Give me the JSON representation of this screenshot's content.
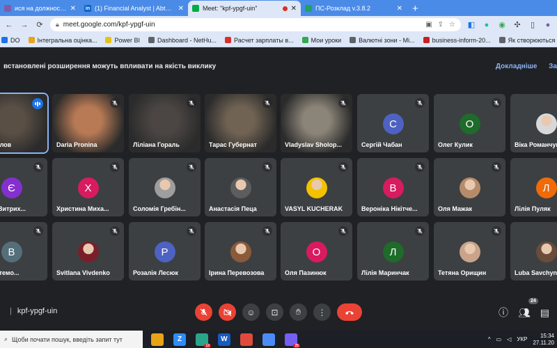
{
  "tabs": [
    {
      "title": "ися на должность «Finan",
      "favicon": "#7b5ea8",
      "letter": "",
      "active": false
    },
    {
      "title": "(1) Financial Analyst | Abto Softw",
      "favicon": "#0a66c2",
      "letter": "in",
      "active": false
    },
    {
      "title": "Meet: \"kpf-ypgf-uin\"",
      "favicon": "#00ac47",
      "letter": "",
      "active": true
    },
    {
      "title": "ПС-Розклад v.3.8.2",
      "favicon": "#1ea362",
      "letter": "",
      "active": false
    }
  ],
  "address": {
    "url": "meet.google.com/kpf-ypgf-uin"
  },
  "bookmarks": [
    {
      "label": "DO",
      "color": "#1a73e8"
    },
    {
      "label": "Інтегральна оцінка...",
      "color": "#e8a317"
    },
    {
      "label": "Power BI",
      "color": "#e8c117"
    },
    {
      "label": "Dashboard - NetHu...",
      "color": "#5f6368"
    },
    {
      "label": "Расчет зарплаты в...",
      "color": "#d93025"
    },
    {
      "label": "Мои уроки",
      "color": "#34a853"
    },
    {
      "label": "Валютні зони - Mi...",
      "color": "#5f6368"
    },
    {
      "label": "business-inform-20...",
      "color": "#c5221f"
    },
    {
      "label": "Як створюються гр...",
      "color": "#5f6368"
    },
    {
      "label": "Усі",
      "color": "#e8a317"
    }
  ],
  "banner": {
    "text": "встановлені розширення можуть впливати на якість виклику",
    "link": "Докладніше",
    "close": "За"
  },
  "participants": [
    {
      "name": "Михайлов",
      "kind": "video",
      "bg": "#5a4f45",
      "speaking": true
    },
    {
      "name": "Daria Pronina",
      "kind": "video",
      "bg": "#b87a55",
      "speaking": false
    },
    {
      "name": "Ліліана Гораль",
      "kind": "video",
      "bg": "#4b4643",
      "speaking": false
    },
    {
      "name": "Тарас Губернат",
      "kind": "video",
      "bg": "#706353",
      "speaking": false
    },
    {
      "name": "Vladyslav Sholop...",
      "kind": "video",
      "bg": "#8b8478",
      "speaking": false
    },
    {
      "name": "Сергій Чабан",
      "kind": "letter",
      "letter": "С",
      "color": "#4e62c2"
    },
    {
      "name": "Олег Кулик",
      "kind": "letter",
      "letter": "О",
      "color": "#1e6b2a"
    },
    {
      "name": "Віка Романчук",
      "kind": "photo",
      "color": "#d8d8d8"
    },
    {
      "name": "рахій Витрих...",
      "kind": "letter",
      "letter": "Є",
      "color": "#8430ce"
    },
    {
      "name": "Христина Миха...",
      "kind": "letter",
      "letter": "Х",
      "color": "#d81b60"
    },
    {
      "name": "Соломія Гребін...",
      "kind": "photo",
      "color": "#9e9e9e"
    },
    {
      "name": "Анастасія Пеца",
      "kind": "photo",
      "color": "#5d5d5d"
    },
    {
      "name": "VASYL KUCHERAK",
      "kind": "photo",
      "color": "#f2c200"
    },
    {
      "name": "Вероніка Нікітче...",
      "kind": "letter",
      "letter": "В",
      "color": "#d81b60"
    },
    {
      "name": "Оля Мажак",
      "kind": "photo",
      "color": "#b58b6a"
    },
    {
      "name": "Лілія Пуляк",
      "kind": "letter",
      "letter": "Л",
      "color": "#f06a0a"
    },
    {
      "name": "рія Артемо...",
      "kind": "letter",
      "letter": "В",
      "color": "#546e7a"
    },
    {
      "name": "Svitlana Vivdenko",
      "kind": "photo",
      "color": "#7a1f2a"
    },
    {
      "name": "Розалія Лесюк",
      "kind": "letter",
      "letter": "Р",
      "color": "#4e62c2"
    },
    {
      "name": "Ірина Перевозова",
      "kind": "photo",
      "color": "#8a5a3a"
    },
    {
      "name": "Оля Пазинюк",
      "kind": "letter",
      "letter": "О",
      "color": "#d81b60"
    },
    {
      "name": "Лілія Маринчак",
      "kind": "letter",
      "letter": "Л",
      "color": "#1e6b2a"
    },
    {
      "name": "Тетяна Орищин",
      "kind": "photo",
      "color": "#c9a38a"
    },
    {
      "name": "Luba Savchyn",
      "kind": "photo",
      "color": "#6b4b3a"
    }
  ],
  "meeting": {
    "code": "kpf-ypgf-uin",
    "participant_count": "24"
  },
  "taskbar": {
    "search_placeholder": "Щоби почати пошук, введіть запит тут",
    "apps": [
      {
        "color": "#e8a317",
        "letter": "",
        "badge": ""
      },
      {
        "color": "#2d8cff",
        "letter": "Z",
        "badge": ""
      },
      {
        "color": "#2aa58a",
        "letter": "",
        "badge": "13"
      },
      {
        "color": "#185abd",
        "letter": "W",
        "badge": ""
      },
      {
        "color": "#e04a3a",
        "letter": "",
        "badge": ""
      },
      {
        "color": "#4c8bf5",
        "letter": "",
        "badge": ""
      },
      {
        "color": "#7360f2",
        "letter": "",
        "badge": "25"
      }
    ],
    "lang": "УКР",
    "time": "15:34",
    "date": "27.11.20"
  }
}
